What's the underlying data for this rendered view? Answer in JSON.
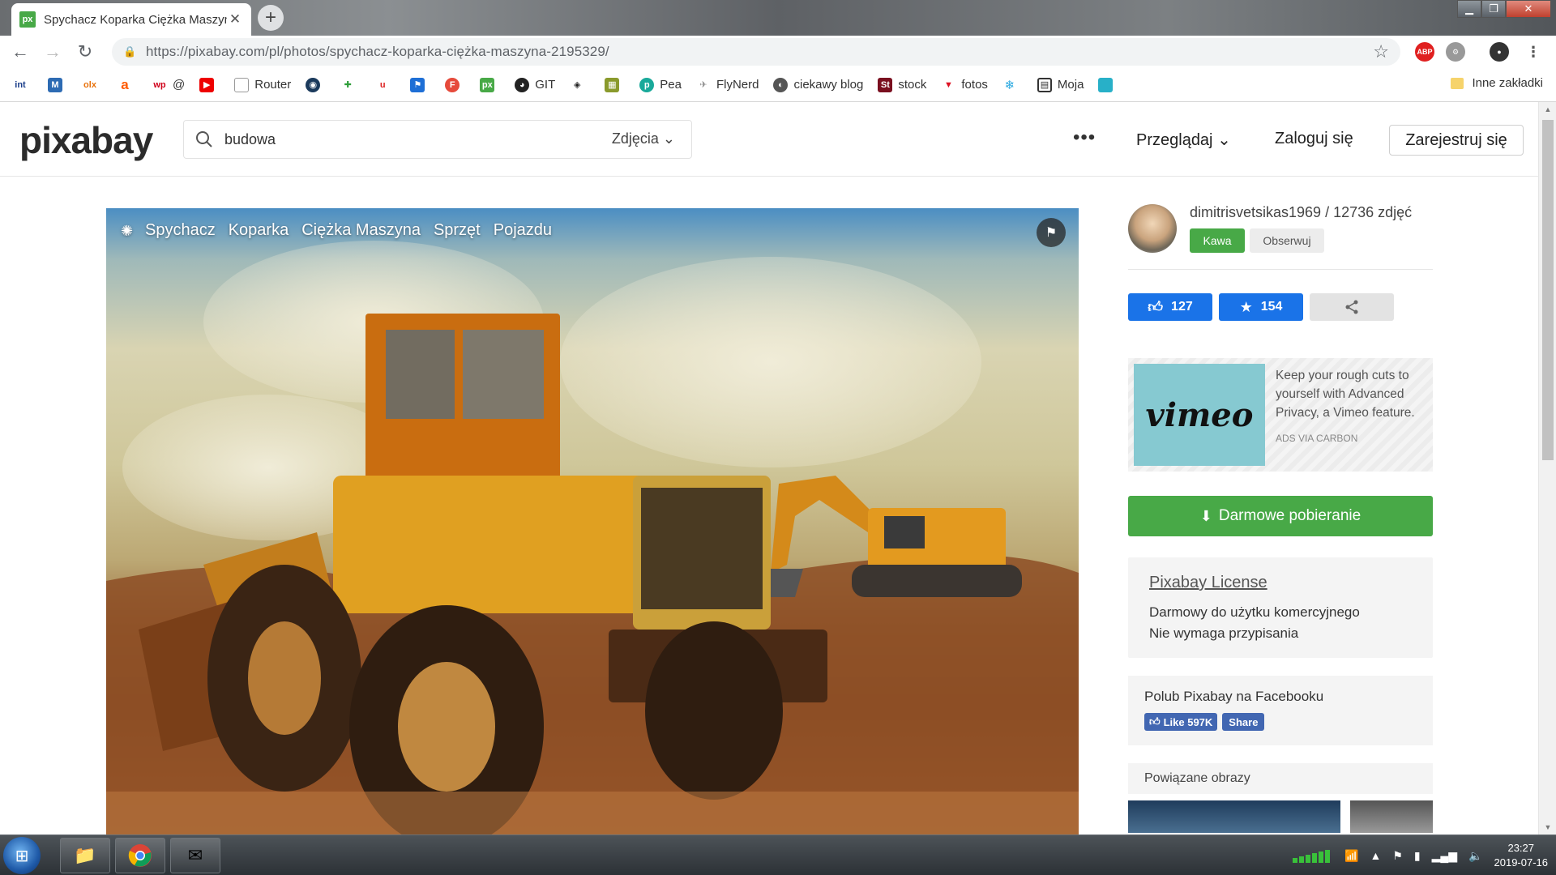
{
  "browser": {
    "tab_title": "Spychacz Koparka Ciężka Maszyna",
    "tab_favicon": "px",
    "url": "https://pixabay.com/pl/photos/spychacz-koparka-ciężka-maszyna-2195329/",
    "bookmarks": [
      {
        "label": "",
        "icon": "int-icon"
      },
      {
        "label": "",
        "icon": "m-icon"
      },
      {
        "label": "",
        "icon": "olx-icon"
      },
      {
        "label": "",
        "icon": "allegro-icon"
      },
      {
        "label": "@",
        "icon": "wp-icon"
      },
      {
        "label": "",
        "icon": "youtube-icon"
      },
      {
        "label": "Router",
        "icon": "page-icon"
      },
      {
        "label": "",
        "icon": "steam-icon"
      },
      {
        "label": "",
        "icon": "app-icon"
      },
      {
        "label": "",
        "icon": "u-icon"
      },
      {
        "label": "",
        "icon": "flag-icon"
      },
      {
        "label": "",
        "icon": "f-icon"
      },
      {
        "label": "",
        "icon": "px-icon"
      },
      {
        "label": "GIT",
        "icon": "github-icon"
      },
      {
        "label": "",
        "icon": "codepen-icon"
      },
      {
        "label": "",
        "icon": "game-icon"
      },
      {
        "label": "Pea",
        "icon": "p-icon"
      },
      {
        "label": "FlyNerd",
        "icon": "flynerd-icon"
      },
      {
        "label": "ciekawy blog",
        "icon": "blog-icon"
      },
      {
        "label": "stock",
        "icon": "stock-icon"
      },
      {
        "label": "fotos",
        "icon": "fotos-icon"
      },
      {
        "label": "",
        "icon": "snowflake-icon"
      },
      {
        "label": "Moja",
        "icon": "moja-icon"
      },
      {
        "label": "",
        "icon": "tile-icon"
      }
    ],
    "other_bookmarks": "Inne zakładki"
  },
  "header": {
    "logo": "pixabay",
    "search_value": "budowa",
    "search_type": "Zdjęcia",
    "more": "•••",
    "browse": "Przeglądaj",
    "login": "Zaloguj się",
    "signup": "Zarejestruj się"
  },
  "photo": {
    "tags": [
      "Spychacz",
      "Koparka",
      "Ciężka Maszyna",
      "Sprzęt",
      "Pojazdu"
    ]
  },
  "sidebar": {
    "author": "dimitrisvetsikas1969 / 12736 zdjęć",
    "coffee": "Kawa",
    "follow": "Obserwuj",
    "likes": "127",
    "favorites": "154",
    "ad": {
      "brand": "vimeo",
      "text": "Keep your rough cuts to yourself with Advanced Privacy, a Vimeo feature.",
      "via": "ADS VIA CARBON"
    },
    "download": "Darmowe pobieranie",
    "license": {
      "title": "Pixabay License",
      "line1": "Darmowy do użytku komercyjnego",
      "line2": "Nie wymaga przypisania"
    },
    "facebook": {
      "title": "Polub Pixabay na Facebooku",
      "like": "Like 597K",
      "share": "Share"
    },
    "related": "Powiązane obrazy"
  },
  "taskbar": {
    "time": "23:27",
    "date": "2019-07-16"
  },
  "colors": {
    "brand_green": "#48a947",
    "button_blue": "#1a73e8",
    "facebook_blue": "#4267b2"
  }
}
